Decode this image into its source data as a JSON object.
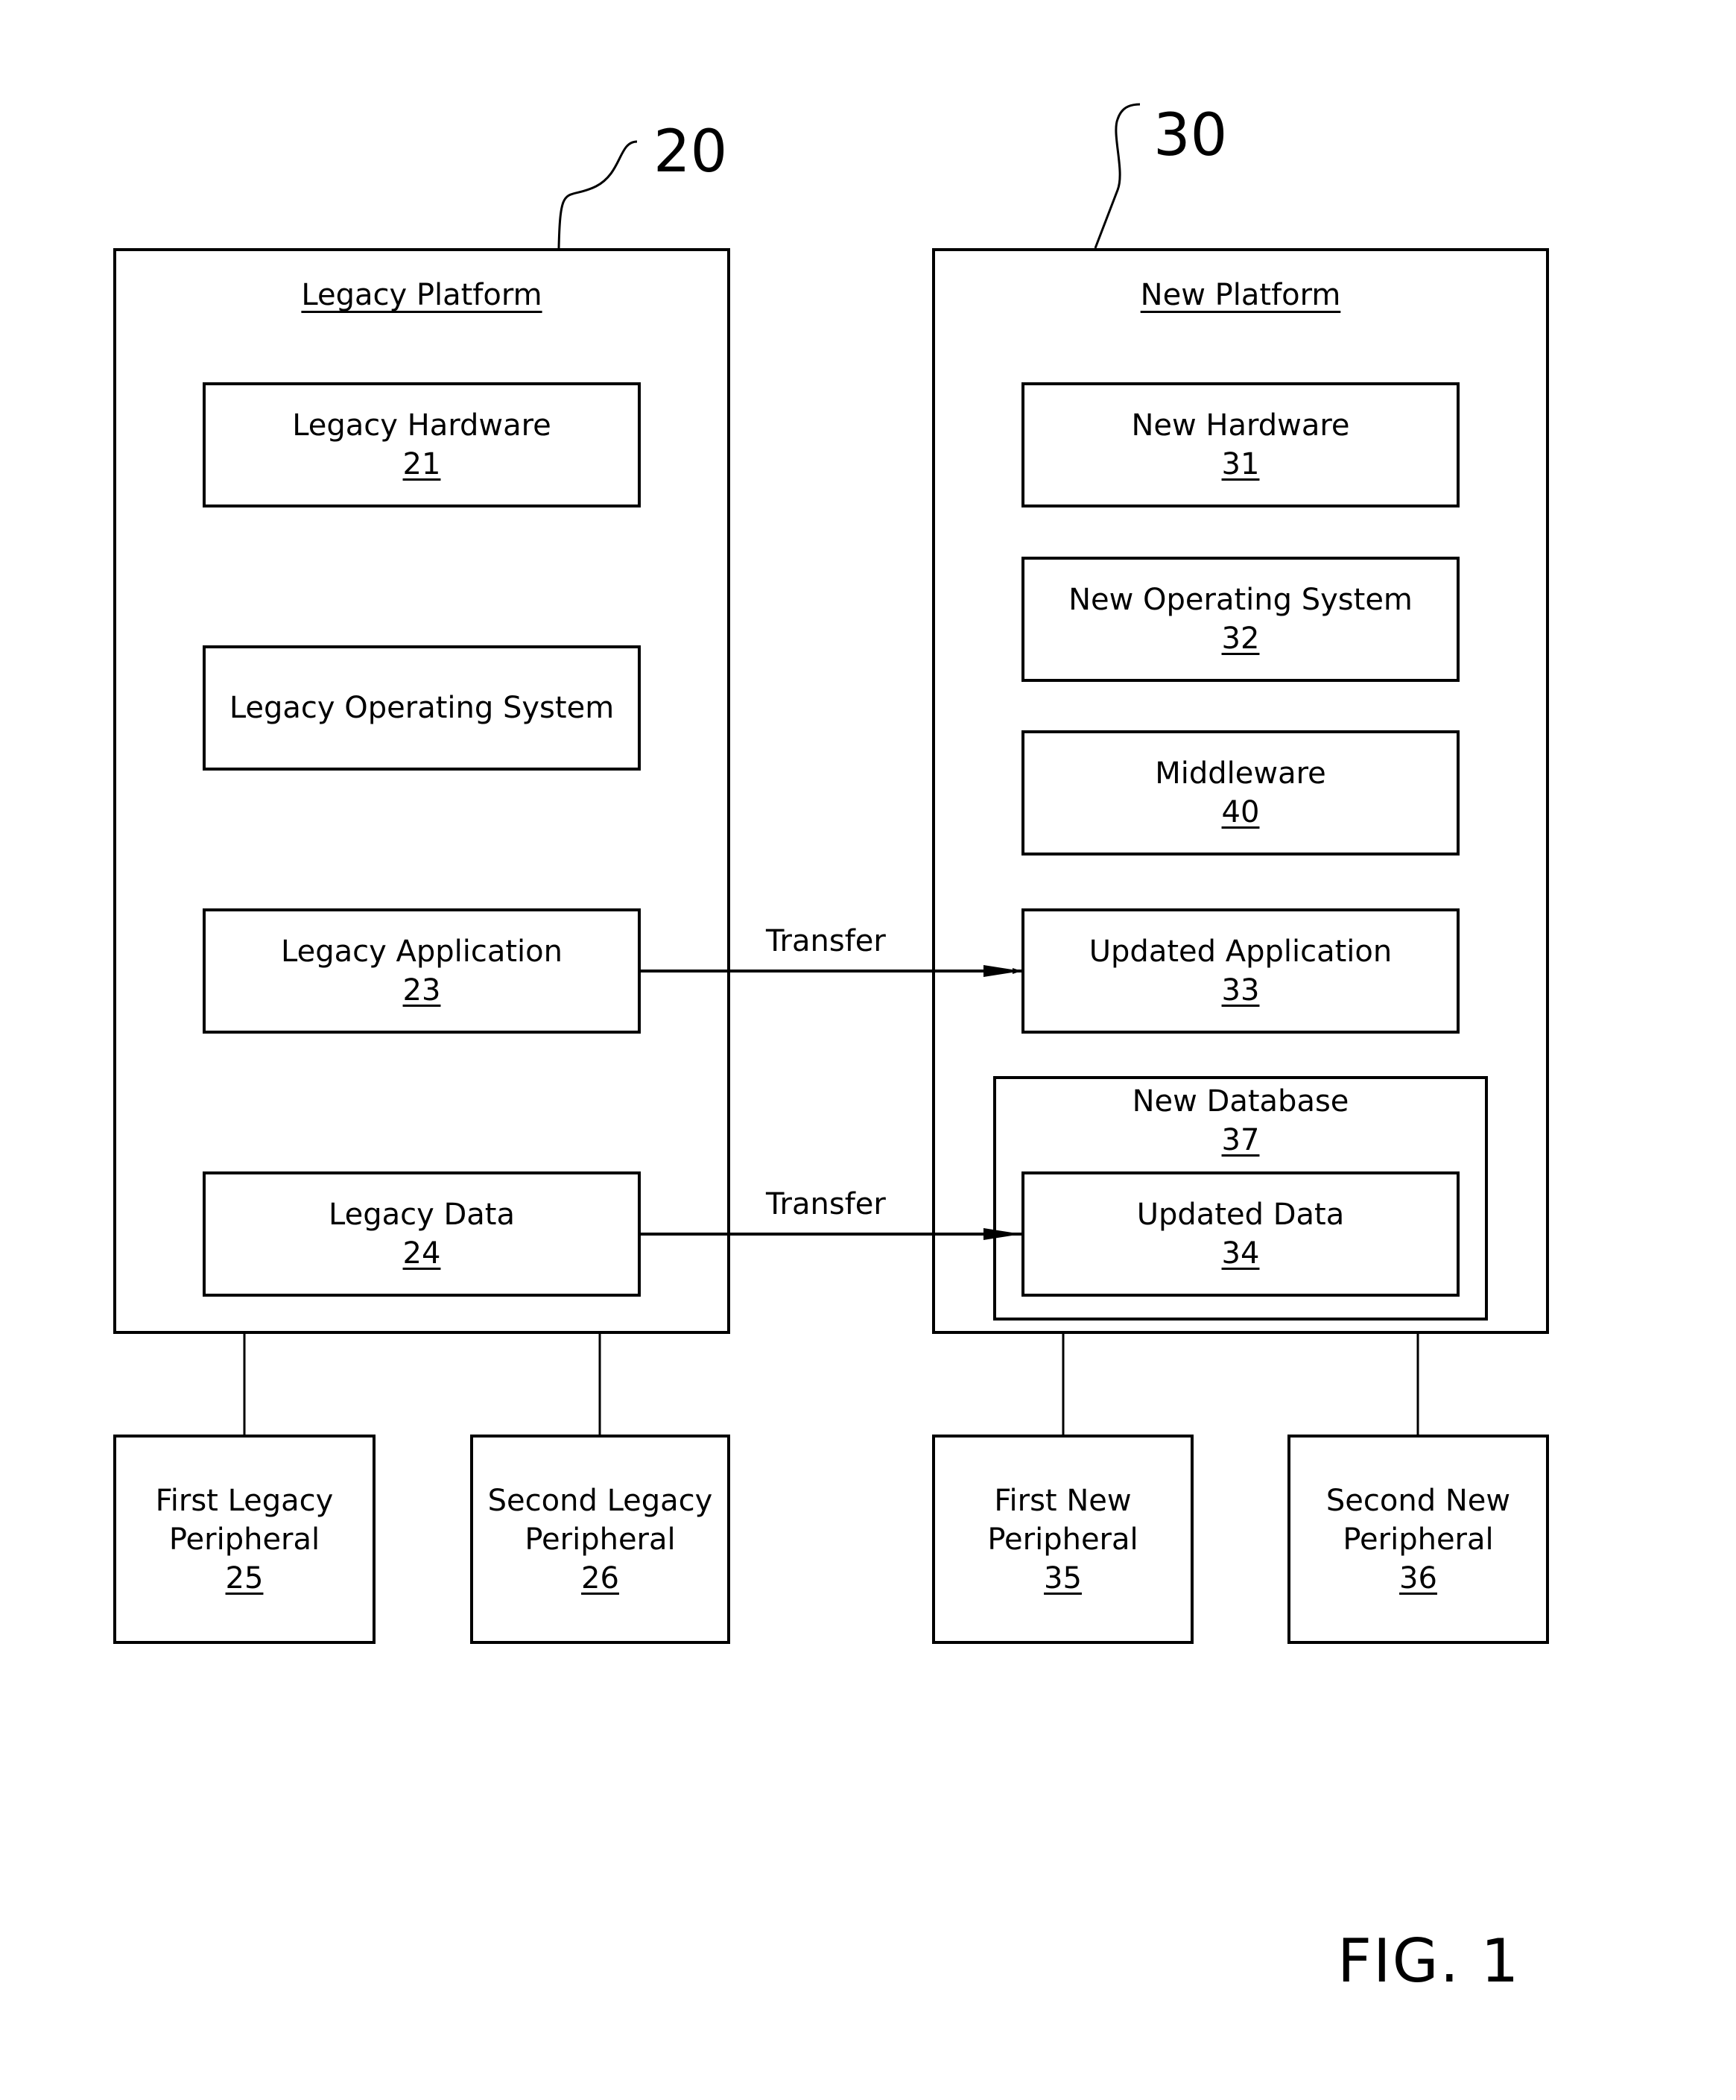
{
  "figure_label": "FIG. 1",
  "legacy_platform": {
    "ref": "20",
    "title": "Legacy Platform",
    "components": [
      {
        "name": "Legacy Hardware",
        "num": "21"
      },
      {
        "name": "Legacy Operating System",
        "num": ""
      },
      {
        "name": "Legacy Application",
        "num": "23"
      },
      {
        "name": "Legacy Data",
        "num": "24"
      }
    ],
    "peripherals": [
      {
        "line1": "First Legacy",
        "line2": "Peripheral",
        "num": "25"
      },
      {
        "line1": "Second Legacy",
        "line2": "Peripheral",
        "num": "26"
      }
    ]
  },
  "new_platform": {
    "ref": "30",
    "title": "New Platform",
    "components": [
      {
        "name": "New Hardware",
        "num": "31"
      },
      {
        "name": "New Operating System",
        "num": "32"
      },
      {
        "name": "Middleware",
        "num": "40"
      },
      {
        "name": "Updated Application",
        "num": "33"
      }
    ],
    "database": {
      "name": "New Database",
      "num": "37",
      "child": {
        "name": "Updated Data",
        "num": "34"
      }
    },
    "peripherals": [
      {
        "line1": "First New",
        "line2": "Peripheral",
        "num": "35"
      },
      {
        "line1": "Second New",
        "line2": "Peripheral",
        "num": "36"
      }
    ]
  },
  "arrows": [
    {
      "label": "Transfer",
      "from": "Legacy Application 23",
      "to": "Updated Application 33"
    },
    {
      "label": "Transfer",
      "from": "Legacy Data 24",
      "to": "Updated Data 34"
    }
  ]
}
